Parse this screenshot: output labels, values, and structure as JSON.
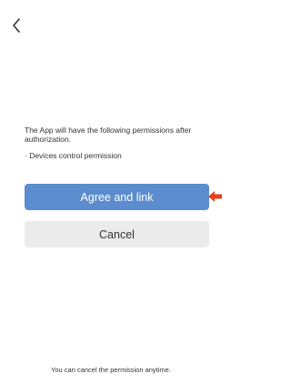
{
  "header": {
    "back_icon": "chevron-left-icon"
  },
  "content": {
    "intro_text": "The App will have the following permissions after authorization.",
    "permission_item": "· Devices control permission"
  },
  "actions": {
    "agree_label": "Agree and link",
    "cancel_label": "Cancel",
    "agree_color": "#5b8ccd",
    "cancel_color": "#ebebeb"
  },
  "annotation": {
    "arrow_icon": "arrow-left-icon",
    "arrow_color": "#e8401c"
  },
  "footer": {
    "note": "You can cancel the permission anytime."
  }
}
